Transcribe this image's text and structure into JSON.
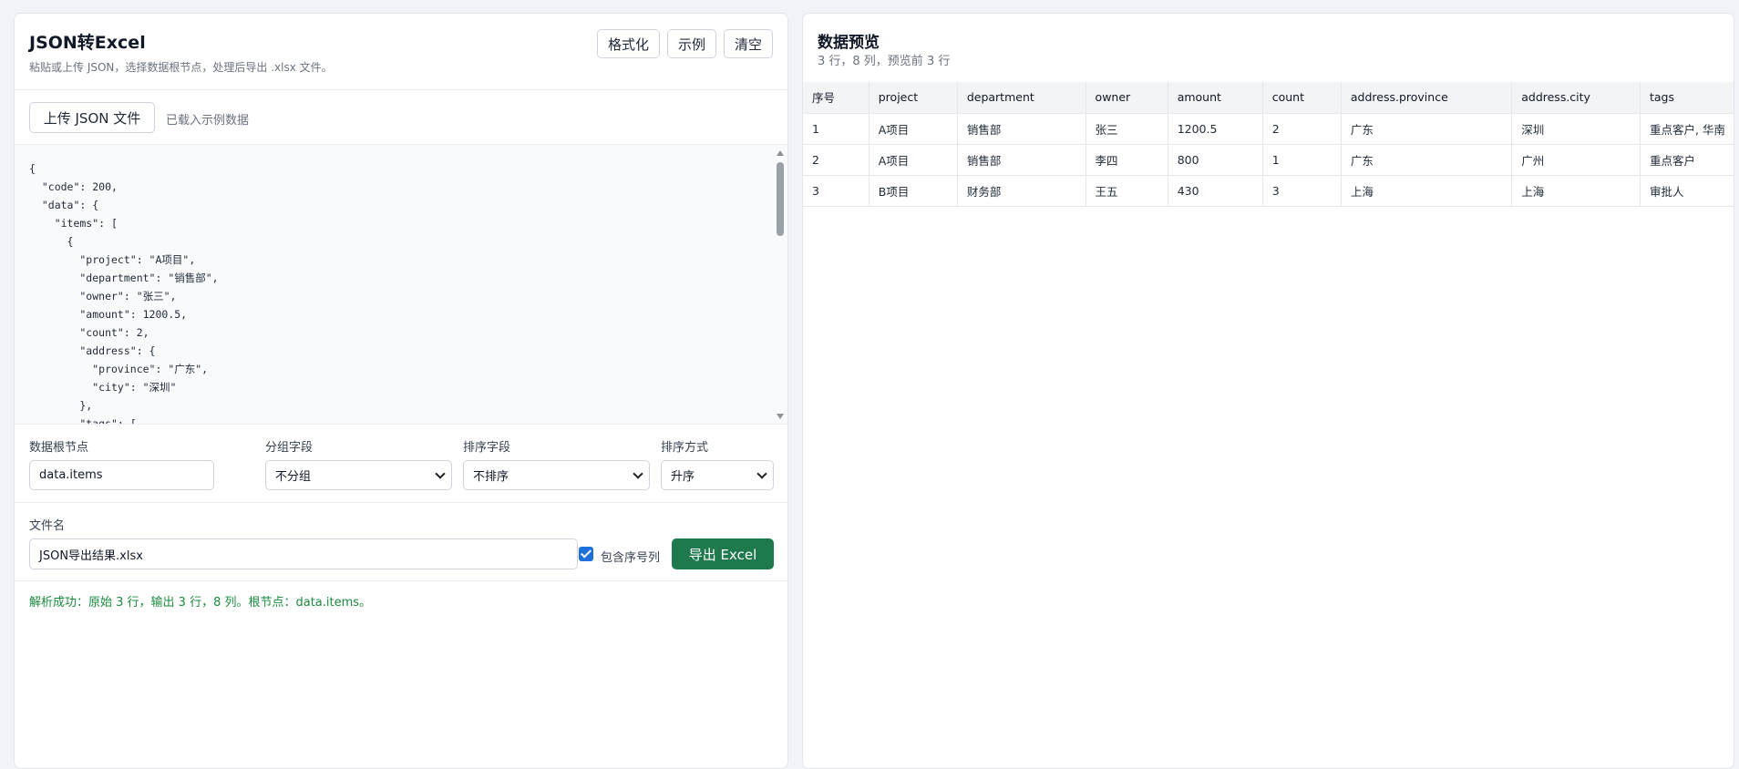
{
  "left": {
    "title": "JSON转Excel",
    "subtitle": "粘贴或上传 JSON，选择数据根节点，处理后导出 .xlsx 文件。",
    "buttons": {
      "format": "格式化",
      "example": "示例",
      "clear": "清空"
    },
    "upload_label": "上传 JSON 文件",
    "upload_note": "已载入示例数据",
    "json_text": "{\n  \"code\": 200,\n  \"data\": {\n    \"items\": [\n      {\n        \"project\": \"A项目\",\n        \"department\": \"销售部\",\n        \"owner\": \"张三\",\n        \"amount\": 1200.5,\n        \"count\": 2,\n        \"address\": {\n          \"province\": \"广东\",\n          \"city\": \"深圳\"\n        },\n        \"tags\": [",
    "controls": {
      "root_label": "数据根节点",
      "root_value": "data.items",
      "group_label": "分组字段",
      "group_value": "不分组",
      "sort_label": "排序字段",
      "sort_value": "不排序",
      "order_label": "排序方式",
      "order_value": "升序"
    },
    "filename_label": "文件名",
    "filename_value": "JSON导出结果.xlsx",
    "include_index_label": "包含序号列",
    "include_index_checked": true,
    "export_label": "导出 Excel",
    "status": "解析成功：原始 3 行，输出 3 行，8 列。根节点：data.items。"
  },
  "right": {
    "title": "数据预览",
    "subtitle": "3 行，8 列，预览前 3 行",
    "columns": [
      "序号",
      "project",
      "department",
      "owner",
      "amount",
      "count",
      "address.province",
      "address.city",
      "tags"
    ],
    "rows": [
      [
        "1",
        "A项目",
        "销售部",
        "张三",
        "1200.5",
        "2",
        "广东",
        "深圳",
        "重点客户, 华南"
      ],
      [
        "2",
        "A项目",
        "销售部",
        "李四",
        "800",
        "1",
        "广东",
        "广州",
        "重点客户"
      ],
      [
        "3",
        "B项目",
        "财务部",
        "王五",
        "430",
        "3",
        "上海",
        "上海",
        "审批人"
      ]
    ]
  },
  "colors": {
    "export_button": "#1e7a4c",
    "status_text": "#1a8a3c",
    "checkbox": "#1e6fd9"
  }
}
